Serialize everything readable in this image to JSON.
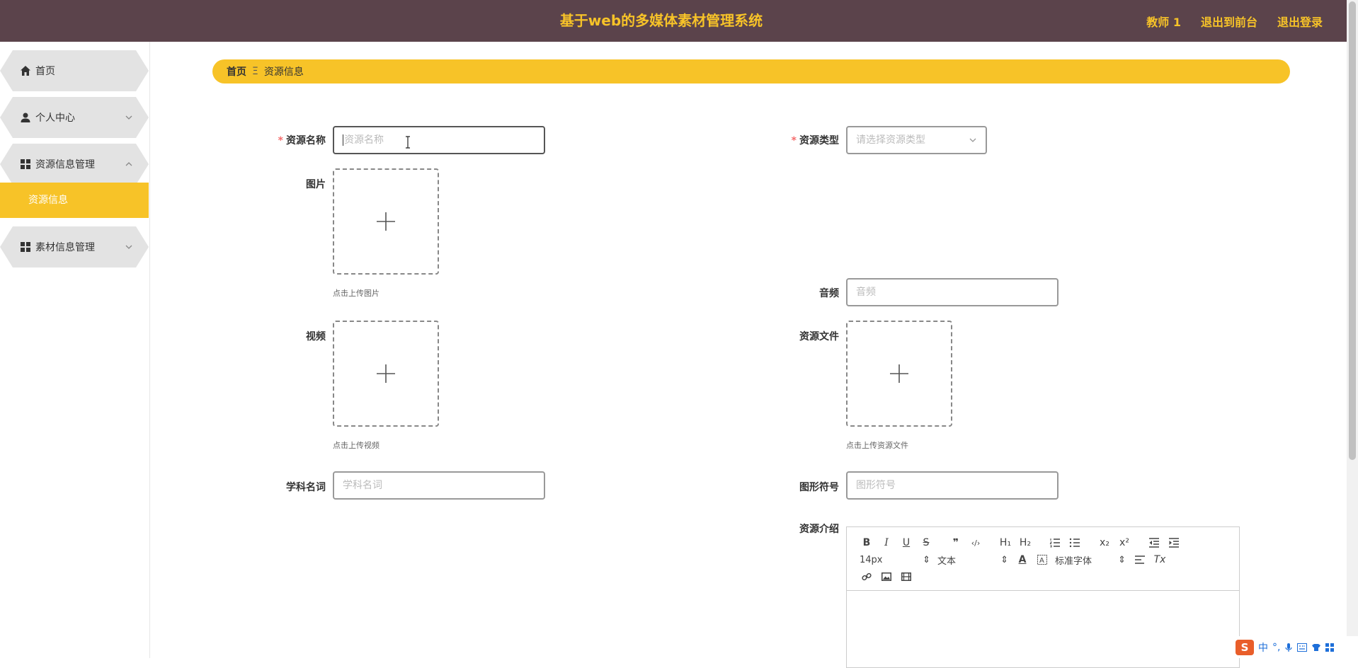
{
  "header": {
    "title": "基于web的多媒体素材管理系统",
    "user": "教师 1",
    "back_to_front": "退出到前台",
    "logout": "退出登录"
  },
  "sidebar": {
    "items": [
      {
        "label": "首页",
        "icon": "home-icon"
      },
      {
        "label": "个人中心",
        "icon": "user-icon"
      },
      {
        "label": "资源信息管理",
        "icon": "grid-icon"
      },
      {
        "label": "素材信息管理",
        "icon": "grid-icon"
      }
    ],
    "sub_item": "资源信息"
  },
  "breadcrumb": {
    "home": "首页",
    "separator": "Ξ",
    "current": "资源信息"
  },
  "form": {
    "resource_name_label": "资源名称",
    "resource_name_placeholder": "资源名称",
    "resource_type_label": "资源类型",
    "resource_type_placeholder": "请选择资源类型",
    "image_label": "图片",
    "image_hint": "点击上传图片",
    "audio_label": "音频",
    "audio_placeholder": "音频",
    "video_label": "视频",
    "video_hint": "点击上传视频",
    "file_label": "资源文件",
    "file_hint": "点击上传资源文件",
    "subject_label": "学科名词",
    "subject_placeholder": "学科名词",
    "symbol_label": "图形符号",
    "symbol_placeholder": "图形符号",
    "intro_label": "资源介绍",
    "required_mark": "*"
  },
  "editor": {
    "bold": "B",
    "italic": "I",
    "underline": "U",
    "strike": "S",
    "quote": "❞",
    "code": "‹/›",
    "h1": "H₁",
    "h2": "H₂",
    "sub": "x₂",
    "sup": "x²",
    "size": "14px",
    "text": "文本",
    "font": "标准字体",
    "color_a": "A",
    "clear": "Tx",
    "select_arrow": "⇕"
  },
  "ime": {
    "logo": "S",
    "lang": "中",
    "punct": "°,"
  },
  "colors": {
    "header_bg": "#5b434b",
    "accent": "#f7c328",
    "required": "#f56c6c"
  }
}
